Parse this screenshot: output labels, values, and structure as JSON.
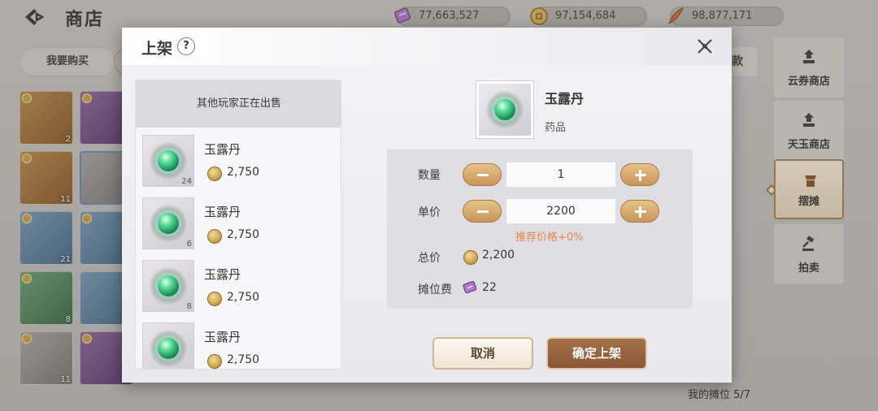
{
  "topbar": {
    "title": "商店",
    "currencies": [
      {
        "icon": "cloud-voucher-icon",
        "value": "77,663,527"
      },
      {
        "icon": "copper-coin-icon",
        "value": "97,154,684"
      },
      {
        "icon": "jade-feather-icon",
        "value": "98,877,171"
      }
    ]
  },
  "background": {
    "buy_tab_label": "我要购买",
    "right_button_partial": "款",
    "item_counts": [
      "2",
      "11",
      "21",
      "8",
      "11"
    ],
    "side_tabs": [
      {
        "label": "云券商店",
        "icon": "cloud-shop-icon"
      },
      {
        "label": "天玉商店",
        "icon": "jade-shop-icon"
      },
      {
        "label": "摆摊",
        "icon": "stall-icon",
        "active": true
      },
      {
        "label": "拍卖",
        "icon": "auction-gavel-icon"
      }
    ],
    "my_stall": "我的摊位 5/7"
  },
  "dialog": {
    "title": "上架",
    "help": "?",
    "list": {
      "header": "其他玩家正在出售",
      "items": [
        {
          "name": "玉露丹",
          "price": "2,750",
          "count": "24"
        },
        {
          "name": "玉露丹",
          "price": "2,750",
          "count": "6"
        },
        {
          "name": "玉露丹",
          "price": "2,750",
          "count": "8"
        },
        {
          "name": "玉露丹",
          "price": "2,750",
          "count": ""
        }
      ]
    },
    "item": {
      "name": "玉露丹",
      "category": "药品"
    },
    "form": {
      "quantity_label": "数量",
      "quantity_value": "1",
      "unit_price_label": "单价",
      "unit_price_value": "2200",
      "suggested": "推荐价格+0%",
      "total_label": "总价",
      "total_value": "2,200",
      "fee_label": "摊位费",
      "fee_value": "22"
    },
    "cancel_label": "取消",
    "confirm_label": "确定上架"
  }
}
